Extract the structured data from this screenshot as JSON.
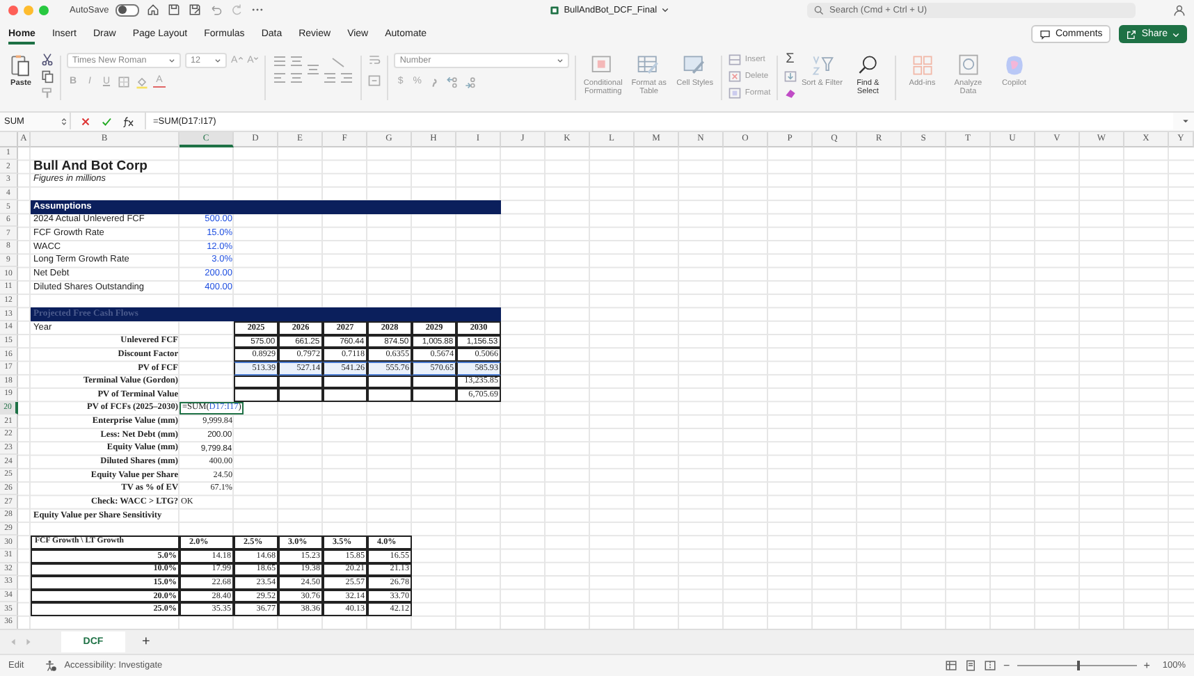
{
  "title_bar": {
    "autosave_label": "AutoSave",
    "autosave_on": false,
    "file_title": "BullAndBot_DCF_Final",
    "search": {
      "placeholder": "Search (Cmd + Ctrl + U)"
    }
  },
  "tabs": [
    {
      "label": "Home",
      "selected": true
    },
    {
      "label": "Insert",
      "selected": false
    },
    {
      "label": "Draw",
      "selected": false
    },
    {
      "label": "Page Layout",
      "selected": false
    },
    {
      "label": "Formulas",
      "selected": false
    },
    {
      "label": "Data",
      "selected": false
    },
    {
      "label": "Review",
      "selected": false
    },
    {
      "label": "View",
      "selected": false
    },
    {
      "label": "Automate",
      "selected": false
    }
  ],
  "comments_button": "Comments",
  "share_button": "Share",
  "ribbon": {
    "paste": "Paste",
    "font_name": "Times New Roman",
    "font_size": "12",
    "grow_font": "A",
    "shrink_font": "A",
    "bold": "B",
    "italic": "I",
    "underline": "U",
    "font_color": "A",
    "number_format": "Number",
    "currency": "$",
    "percent": "%",
    "style_commands": [
      {
        "label": "Conditional Formatting",
        "kind": "conditional",
        "disabled": true
      },
      {
        "label": "Format as Table",
        "kind": "table",
        "disabled": true
      },
      {
        "label": "Cell Styles",
        "kind": "styles",
        "disabled": true
      }
    ],
    "cell_commands": [
      {
        "label": "Insert",
        "kind": "insert",
        "disabled": true
      },
      {
        "label": "Delete",
        "kind": "delete",
        "disabled": true
      },
      {
        "label": "Format",
        "kind": "format",
        "disabled": true
      }
    ],
    "sum_symbol": "Σ",
    "edit_commands": [
      {
        "label": "Sort & Filter",
        "kind": "sort",
        "disabled": true
      },
      {
        "label": "Find & Select",
        "kind": "find",
        "disabled": false
      }
    ],
    "extra_commands": [
      {
        "label": "Add-ins",
        "kind": "addins",
        "disabled": true
      },
      {
        "label": "Analyze Data",
        "kind": "analyze",
        "disabled": true
      },
      {
        "label": "Copilot",
        "kind": "copilot",
        "disabled": true
      }
    ]
  },
  "formula_bar": {
    "name_box": "SUM",
    "formula": "=SUM(D17:I17)"
  },
  "columns": [
    {
      "label": "A",
      "selected": false
    },
    {
      "label": "B",
      "selected": false
    },
    {
      "label": "C",
      "selected": true
    },
    {
      "label": "D",
      "selected": false
    },
    {
      "label": "E",
      "selected": false
    },
    {
      "label": "F",
      "selected": false
    },
    {
      "label": "G",
      "selected": false
    },
    {
      "label": "H",
      "selected": false
    },
    {
      "label": "I",
      "selected": false
    },
    {
      "label": "J",
      "selected": false
    },
    {
      "label": "K",
      "selected": false
    },
    {
      "label": "L",
      "selected": false
    },
    {
      "label": "M",
      "selected": false
    },
    {
      "label": "N",
      "selected": false
    },
    {
      "label": "O",
      "selected": false
    },
    {
      "label": "P",
      "selected": false
    },
    {
      "label": "Q",
      "selected": false
    },
    {
      "label": "R",
      "selected": false
    },
    {
      "label": "S",
      "selected": false
    },
    {
      "label": "T",
      "selected": false
    },
    {
      "label": "U",
      "selected": false
    },
    {
      "label": "V",
      "selected": false
    },
    {
      "label": "W",
      "selected": false
    },
    {
      "label": "X",
      "selected": false
    },
    {
      "label": "Y",
      "selected": false
    }
  ],
  "row_numbers": [
    {
      "label": "1",
      "selected": false
    },
    {
      "label": "2",
      "selected": false
    },
    {
      "label": "3",
      "selected": false
    },
    {
      "label": "4",
      "selected": false
    },
    {
      "label": "5",
      "selected": false
    },
    {
      "label": "6",
      "selected": false
    },
    {
      "label": "7",
      "selected": false
    },
    {
      "label": "8",
      "selected": false
    },
    {
      "label": "9",
      "selected": false
    },
    {
      "label": "10",
      "selected": false
    },
    {
      "label": "11",
      "selected": false
    },
    {
      "label": "12",
      "selected": false
    },
    {
      "label": "13",
      "selected": false
    },
    {
      "label": "14",
      "selected": false
    },
    {
      "label": "15",
      "selected": false
    },
    {
      "label": "16",
      "selected": false
    },
    {
      "label": "17",
      "selected": false
    },
    {
      "label": "18",
      "selected": false
    },
    {
      "label": "19",
      "selected": false
    },
    {
      "label": "20",
      "selected": true
    },
    {
      "label": "21",
      "selected": false
    },
    {
      "label": "22",
      "selected": false
    },
    {
      "label": "23",
      "selected": false
    },
    {
      "label": "24",
      "selected": false
    },
    {
      "label": "25",
      "selected": false
    },
    {
      "label": "26",
      "selected": false
    },
    {
      "label": "27",
      "selected": false
    },
    {
      "label": "28",
      "selected": false
    },
    {
      "label": "29",
      "selected": false
    },
    {
      "label": "30",
      "selected": false
    },
    {
      "label": "31",
      "selected": false
    },
    {
      "label": "32",
      "selected": false
    },
    {
      "label": "33",
      "selected": false
    },
    {
      "label": "34",
      "selected": false
    },
    {
      "label": "35",
      "selected": false
    },
    {
      "label": "36",
      "selected": false
    }
  ],
  "sheet": {
    "title": "Bull And Bot Corp",
    "subtitle": "Figures in millions",
    "assumptions": {
      "header": "Assumptions",
      "items": [
        {
          "label": "2024 Actual Unlevered FCF",
          "value": "500.00"
        },
        {
          "label": "FCF Growth Rate",
          "value": "15.0%"
        },
        {
          "label": "WACC",
          "value": "12.0%"
        },
        {
          "label": "Long Term Growth Rate",
          "value": "3.0%"
        },
        {
          "label": "Net Debt",
          "value": "200.00"
        },
        {
          "label": "Diluted Shares Outstanding",
          "value": "400.00"
        }
      ]
    },
    "projections": {
      "header": "Projected Free Cash Flows",
      "year_label": "Year",
      "years": [
        "2025",
        "2026",
        "2027",
        "2028",
        "2029",
        "2030"
      ],
      "rows": [
        {
          "label": "Unlevered FCF",
          "kind": "sans",
          "values": [
            "575.00",
            "661.25",
            "760.44",
            "874.50",
            "1,005.88",
            "1,156.53"
          ],
          "referenced": false
        },
        {
          "label": "Discount Factor",
          "kind": "serif",
          "values": [
            "0.8929",
            "0.7972",
            "0.7118",
            "0.6355",
            "0.5674",
            "0.5066"
          ],
          "referenced": false
        },
        {
          "label": "PV of FCF",
          "kind": "serif",
          "values": [
            "513.39",
            "527.14",
            "541.26",
            "555.76",
            "570.65",
            "585.93"
          ],
          "referenced": true
        },
        {
          "label": "Terminal Value (Gordon)",
          "kind": "terminal",
          "last_value": "13,235.85",
          "referenced": false
        },
        {
          "label": "PV of Terminal Value",
          "kind": "terminal",
          "last_value": "6,705.69",
          "referenced": false
        }
      ]
    },
    "summary": [
      {
        "label": "PV of FCFs (2025–2030)",
        "kind": "editing",
        "parts": [
          {
            "text": "=SUM(",
            "ref": false
          },
          {
            "text": "D17:I17",
            "ref": true
          },
          {
            "text": ")",
            "ref": false
          }
        ]
      },
      {
        "label": "Enterprise Value (mm)",
        "kind": "serif",
        "value": "9,999.84"
      },
      {
        "label": "Less: Net Debt (mm)",
        "kind": "sans",
        "value": "200.00"
      },
      {
        "label": "Equity Value (mm)",
        "kind": "sans",
        "value": "9,799.84"
      },
      {
        "label": "Diluted Shares (mm)",
        "kind": "serif",
        "value": "400.00"
      },
      {
        "label": "Equity Value per Share",
        "kind": "serif",
        "value": "24.50"
      },
      {
        "label": "TV as % of EV",
        "kind": "serif",
        "value": "67.1%"
      },
      {
        "label": "Check: WACC > LTG?",
        "kind": "check",
        "value": "OK"
      }
    ],
    "sensitivity": {
      "title": "Equity Value per Share Sensitivity",
      "corner": "FCF Growth \\ LT Growth",
      "columns": [
        "2.0%",
        "2.5%",
        "3.0%",
        "3.5%",
        "4.0%"
      ],
      "rows": [
        {
          "label": "5.0%",
          "values": [
            "14.18",
            "14.68",
            "15.23",
            "15.85",
            "16.55"
          ]
        },
        {
          "label": "10.0%",
          "values": [
            "17.99",
            "18.65",
            "19.38",
            "20.21",
            "21.13"
          ]
        },
        {
          "label": "15.0%",
          "values": [
            "22.68",
            "23.54",
            "24.50",
            "25.57",
            "26.78"
          ]
        },
        {
          "label": "20.0%",
          "values": [
            "28.40",
            "29.52",
            "30.76",
            "32.14",
            "33.70"
          ]
        },
        {
          "label": "25.0%",
          "values": [
            "35.35",
            "36.77",
            "38.36",
            "40.13",
            "42.12"
          ]
        }
      ]
    }
  },
  "sheet_tabs": [
    {
      "label": "DCF",
      "selected": true
    }
  ],
  "add_sheet": "+",
  "status_bar": {
    "mode": "Edit",
    "accessibility": "Accessibility: Investigate",
    "zoom_out": "−",
    "zoom_in": "+",
    "zoom": {
      "level": 0.5
    },
    "zoom_text": "100%"
  }
}
